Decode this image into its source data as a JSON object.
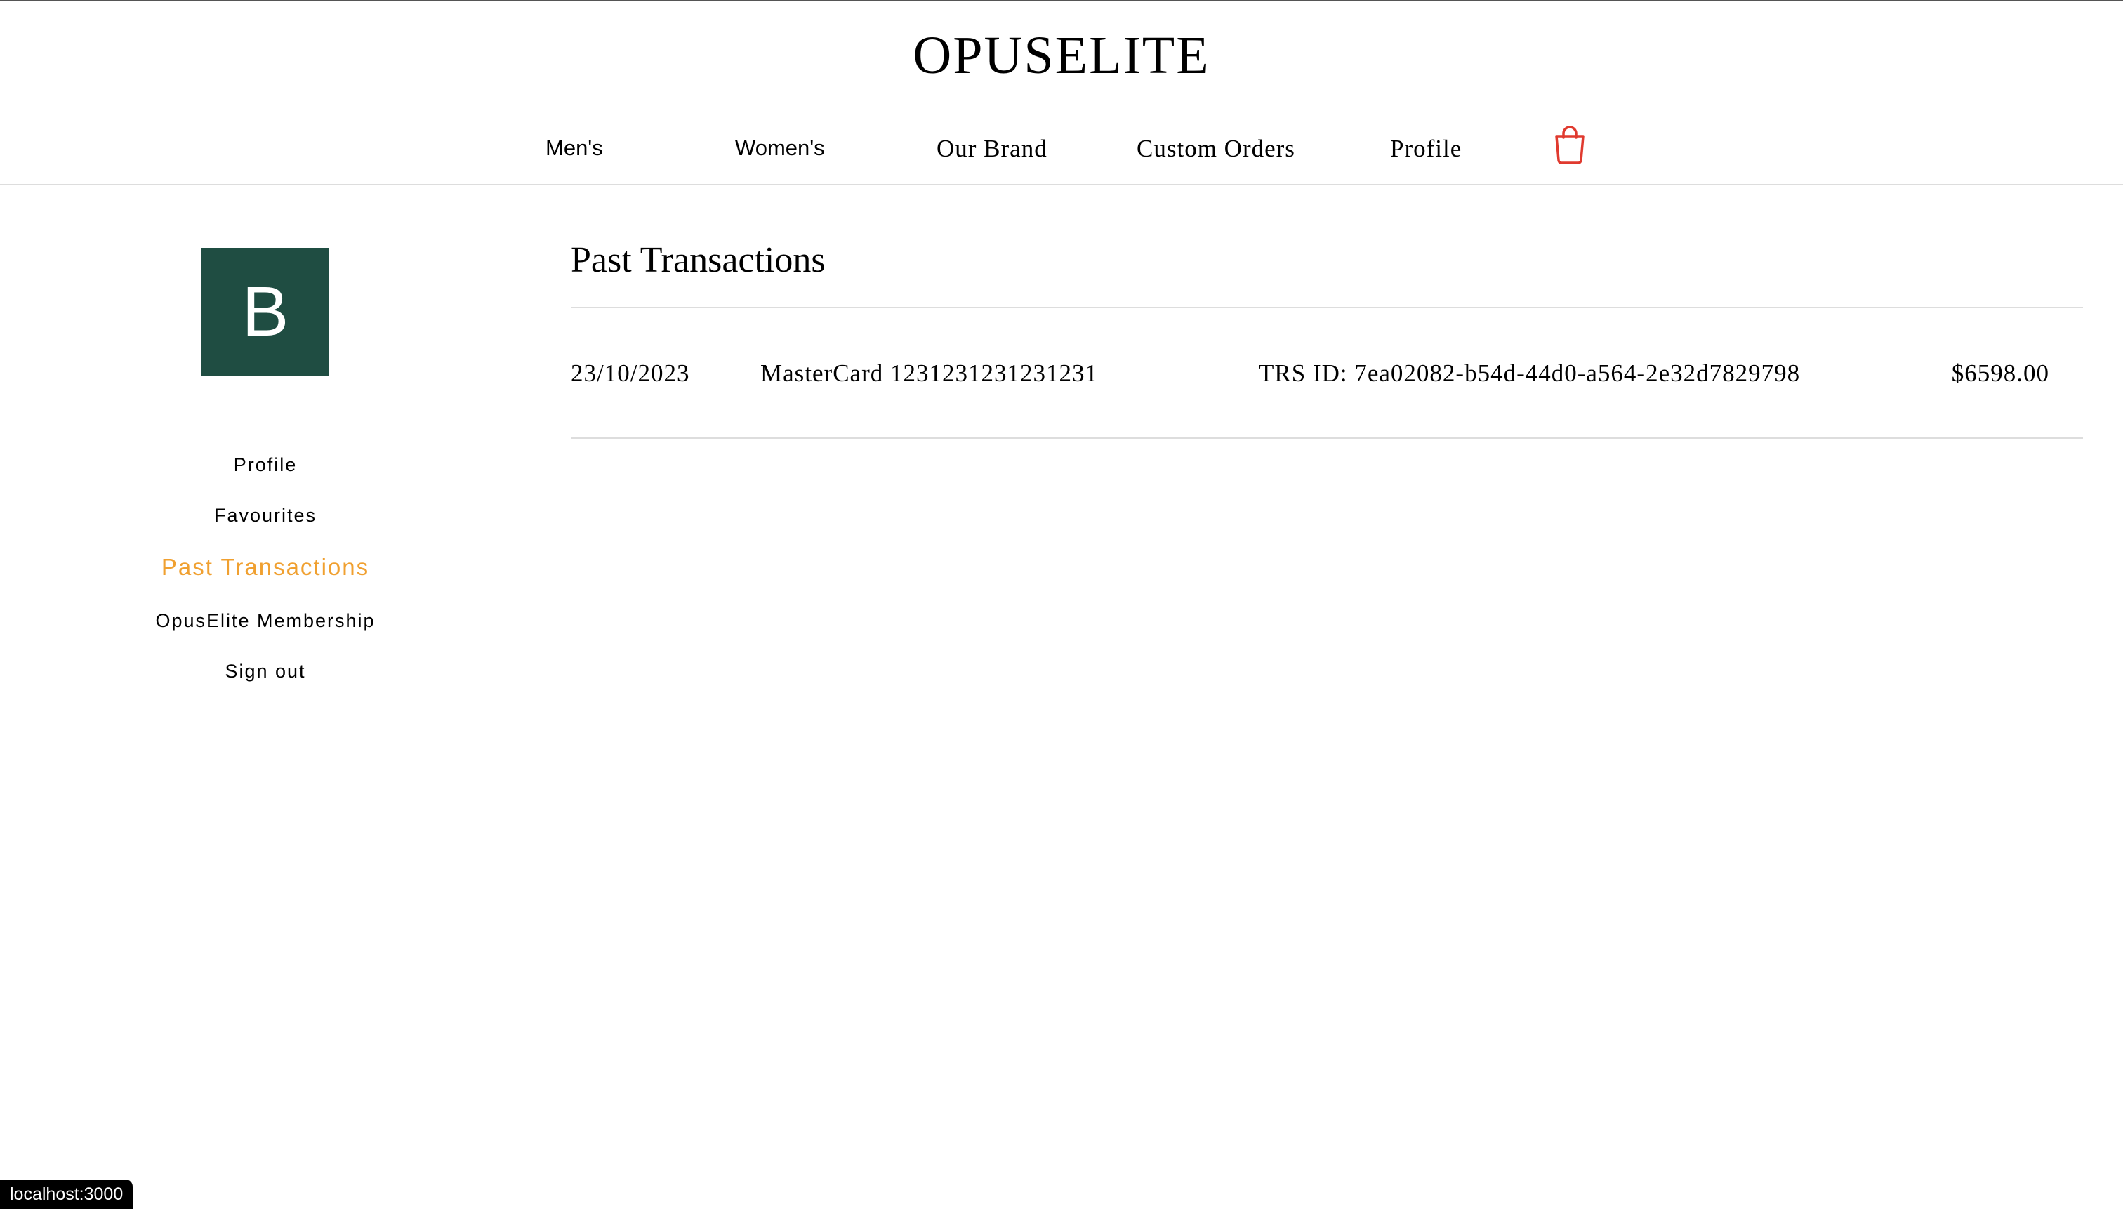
{
  "header": {
    "brand": "OPUSELITE",
    "nav": [
      "Men's",
      "Women's",
      "Our Brand",
      "Custom Orders",
      "Profile"
    ],
    "cart_icon": "shopping-bag-icon",
    "cart_color": "#e03a2f"
  },
  "sidebar": {
    "avatar_letter": "B",
    "avatar_color": "#1f4d42",
    "items": [
      "Profile",
      "Favourites",
      "Past Transactions",
      "OpusElite Membership",
      "Sign out"
    ],
    "active_item": "Past Transactions",
    "active_color": "#f0a030"
  },
  "main": {
    "title": "Past Transactions",
    "transactions": [
      {
        "date": "23/10/2023",
        "card": "MasterCard 1231231231231231",
        "trs_id": "TRS ID: 7ea02082-b54d-44d0-a564-2e32d7829798",
        "amount": "$6598.00"
      }
    ]
  },
  "status_bar": {
    "url": "localhost:3000"
  }
}
